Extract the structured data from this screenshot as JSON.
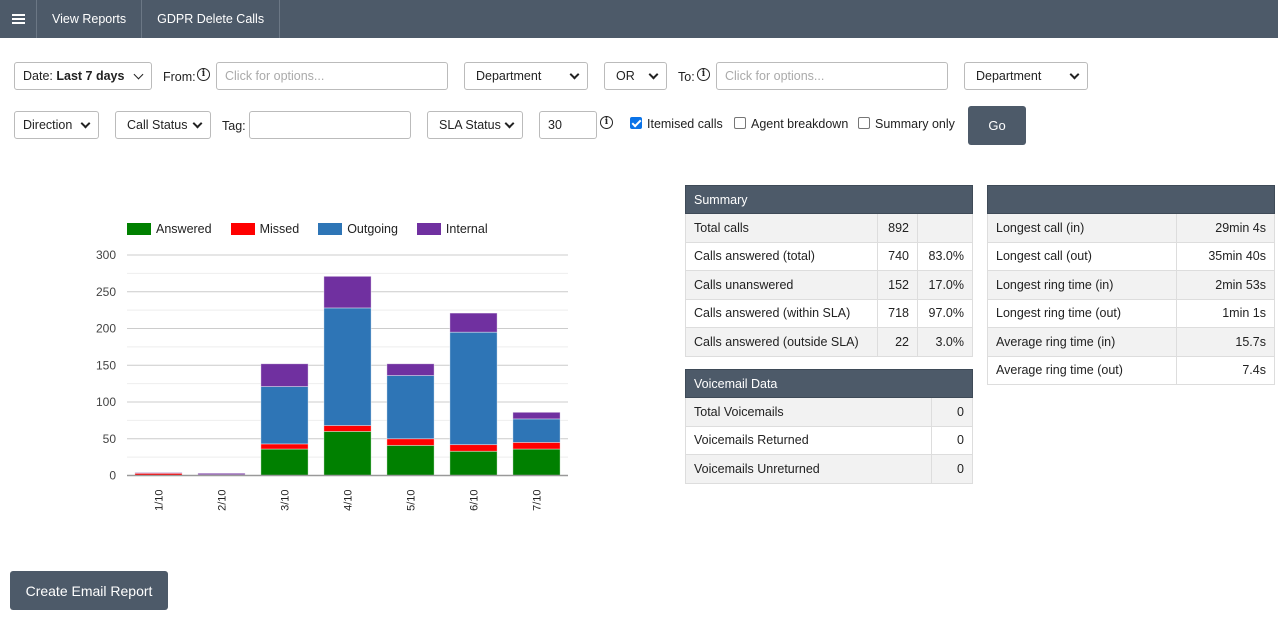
{
  "topbar": {
    "menu_icon": "hamburger-menu-icon",
    "items": [
      "View Reports",
      "GDPR Delete Calls"
    ]
  },
  "filters": {
    "date_prefix": "Date: ",
    "date_value": "Last 7 days",
    "from_label": "From:",
    "from_placeholder": "Click for options...",
    "from_department": "Department",
    "logic": "OR",
    "to_label": "To:",
    "to_placeholder": "Click for options...",
    "to_department": "Department",
    "direction": "Direction",
    "call_status": "Call Status",
    "tag_label": "Tag:",
    "tag_value": "",
    "sla_status": "SLA Status",
    "sla_seconds": "30",
    "itemised_calls": {
      "label": "Itemised calls",
      "checked": true
    },
    "agent_breakdown": {
      "label": "Agent breakdown",
      "checked": false
    },
    "summary_only": {
      "label": "Summary only",
      "checked": false
    },
    "go_label": "Go"
  },
  "chart_data": {
    "type": "bar",
    "stacked": true,
    "categories": [
      "1/10",
      "2/10",
      "3/10",
      "4/10",
      "5/10",
      "6/10",
      "7/10"
    ],
    "series": [
      {
        "name": "Answered",
        "color": "#008000",
        "values": [
          0,
          0,
          36,
          60,
          41,
          33,
          36
        ]
      },
      {
        "name": "Missed",
        "color": "#ff0000",
        "values": [
          3,
          1,
          7,
          8,
          9,
          9,
          9
        ]
      },
      {
        "name": "Outgoing",
        "color": "#2e75b6",
        "values": [
          0,
          0,
          78,
          160,
          86,
          153,
          32
        ]
      },
      {
        "name": "Internal",
        "color": "#7030a0",
        "values": [
          1,
          2,
          31,
          43,
          16,
          26,
          9
        ]
      }
    ],
    "yticks": [
      0,
      50,
      100,
      150,
      200,
      250,
      300
    ],
    "ylim": [
      0,
      300
    ],
    "grid": true,
    "legend": "top",
    "title": "",
    "xlabel": "",
    "ylabel": ""
  },
  "summary": {
    "title": "Summary",
    "rows": [
      {
        "label": "Total calls",
        "value": "892",
        "pct": ""
      },
      {
        "label": "Calls answered (total)",
        "value": "740",
        "pct": "83.0%"
      },
      {
        "label": "Calls unanswered",
        "value": "152",
        "pct": "17.0%"
      },
      {
        "label": "Calls answered (within SLA)",
        "value": "718",
        "pct": "97.0%"
      },
      {
        "label": "Calls answered (outside SLA)",
        "value": "22",
        "pct": "3.0%"
      }
    ]
  },
  "voicemail": {
    "title": "Voicemail Data",
    "rows": [
      {
        "label": "Total Voicemails",
        "value": "0"
      },
      {
        "label": "Voicemails Returned",
        "value": "0"
      },
      {
        "label": "Voicemails Unreturned",
        "value": "0"
      }
    ]
  },
  "timings": {
    "title": "",
    "rows": [
      {
        "label": "Longest call (in)",
        "value": "29min 4s"
      },
      {
        "label": "Longest call (out)",
        "value": "35min 40s"
      },
      {
        "label": "Longest ring time (in)",
        "value": "2min 53s"
      },
      {
        "label": "Longest ring time (out)",
        "value": "1min 1s"
      },
      {
        "label": "Average ring time (in)",
        "value": "15.7s"
      },
      {
        "label": "Average ring time (out)",
        "value": "7.4s"
      }
    ]
  },
  "create_email_report_label": "Create Email Report"
}
